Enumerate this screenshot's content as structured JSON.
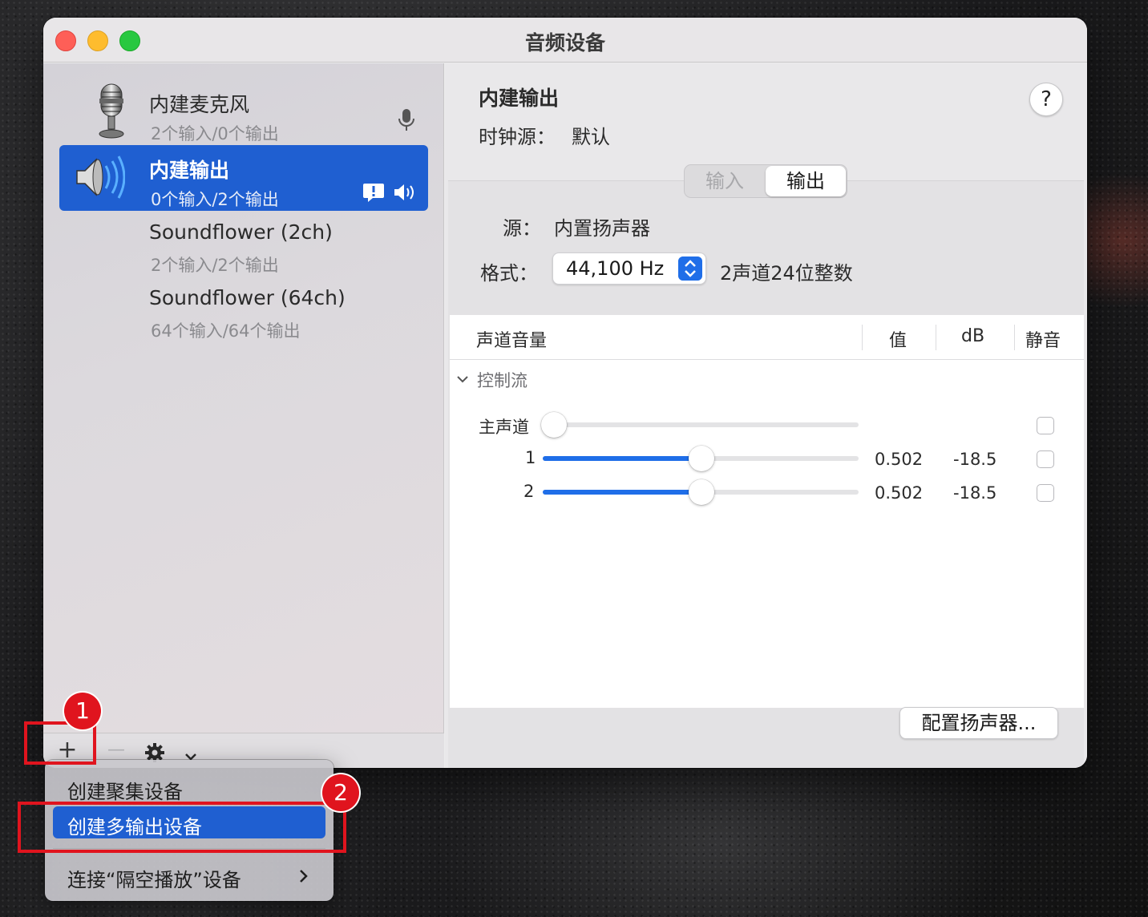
{
  "window": {
    "title": "音频设备"
  },
  "devices": [
    {
      "name": "内建麦克风",
      "sub": "2个输入/0个输出",
      "icon": "microphone-icon"
    },
    {
      "name": "内建输出",
      "sub": "0个输入/2个输出",
      "icon": "speaker-icon",
      "selected": true
    },
    {
      "name": "Soundflower (2ch)",
      "sub": "2个输入/2个输出"
    },
    {
      "name": "Soundflower (64ch)",
      "sub": "64个输入/64个输出"
    }
  ],
  "sidebar_toolbar": {
    "add": "+",
    "remove": "—"
  },
  "detail": {
    "title": "内建输出",
    "clock_label": "时钟源：",
    "clock_value": "默认",
    "help": "?",
    "tabs": [
      "输入",
      "输出"
    ],
    "active_tab": "输出",
    "source_label": "源：",
    "source_value": "内置扬声器",
    "format_label": "格式：",
    "format_value": "44,100 Hz",
    "format_desc": "2声道24位整数",
    "table_headers": {
      "channel": "声道音量",
      "value": "值",
      "db": "dB",
      "mute": "静音"
    },
    "section": "控制流",
    "rows": [
      {
        "label": "主声道",
        "value": "",
        "db": "",
        "level": 0
      },
      {
        "label": "1",
        "value": "0.502",
        "db": "-18.5",
        "level": 0.502
      },
      {
        "label": "2",
        "value": "0.502",
        "db": "-18.5",
        "level": 0.502
      }
    ],
    "config_button": "配置扬声器..."
  },
  "menu": {
    "items": [
      "创建聚集设备",
      "创建多输出设备",
      "连接“隔空播放”设备"
    ],
    "highlighted": "创建多输出设备"
  },
  "annotations": [
    "1",
    "2"
  ],
  "colors": {
    "accent": "#1f5fd1",
    "annotation": "#e0141e"
  }
}
